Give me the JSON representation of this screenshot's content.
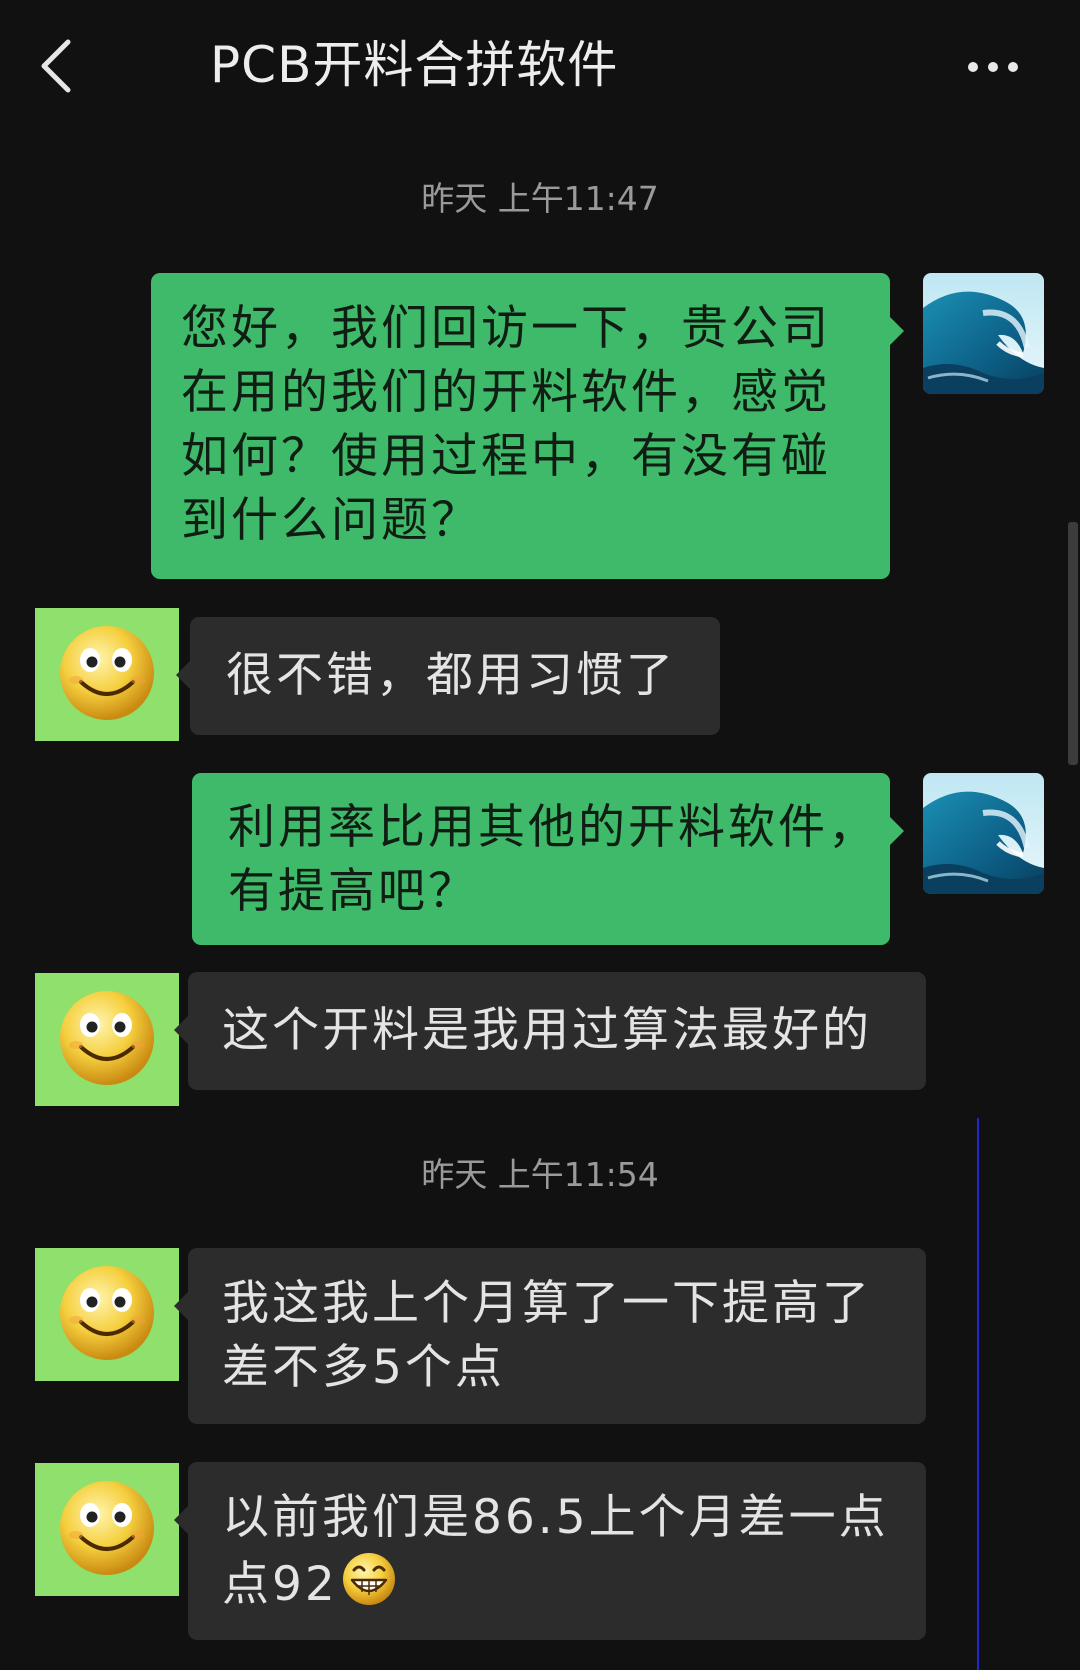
{
  "header": {
    "title": "PCB开料合拼软件"
  },
  "timestamps": [
    "昨天 上午11:47",
    "昨天 上午11:54"
  ],
  "messages": [
    {
      "from": "self",
      "lines": [
        "您好，我们回访一下，贵公司",
        "在用的我们的开料软件，感觉",
        "如何？使用过程中，有没有碰",
        "到什么问题？"
      ]
    },
    {
      "from": "contact",
      "lines": [
        "很不错，都用习惯了"
      ]
    },
    {
      "from": "self",
      "lines": [
        "利用率比用其他的开料软件，",
        "有提高吧？"
      ]
    },
    {
      "from": "contact",
      "lines": [
        "这个开料是我用过算法最好的"
      ]
    },
    {
      "from": "contact",
      "lines": [
        "我这我上个月算了一下提高了",
        "差不多5个点"
      ]
    },
    {
      "from": "contact",
      "lines": [
        "以前我们是86.5上个月差一点",
        "点92"
      ]
    }
  ],
  "icons": {
    "back": "chevron-left-icon",
    "more": "more-horizontal-icon",
    "self_avatar": "ocean-wave-avatar",
    "contact_avatar": "smiley-face-avatar",
    "emoji": "grinning-face-emoji"
  },
  "colors": {
    "background": "#111111",
    "sent_bubble": "#3fb96a",
    "received_bubble": "#2c2c2c",
    "contact_avatar_bg": "#8fe06c"
  }
}
